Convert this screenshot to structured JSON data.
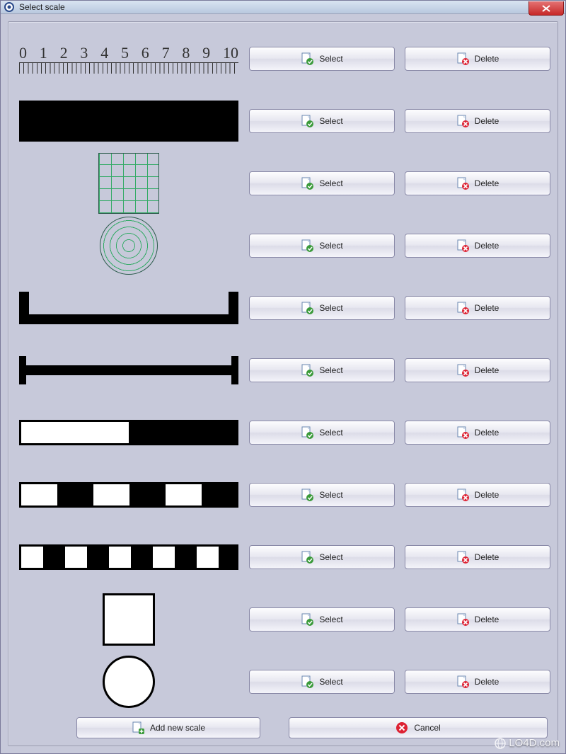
{
  "window": {
    "title": "Select scale"
  },
  "ruler_labels": [
    "0",
    "1",
    "2",
    "3",
    "4",
    "5",
    "6",
    "7",
    "8",
    "9",
    "10"
  ],
  "buttons": {
    "select": "Select",
    "delete": "Delete",
    "add": "Add new scale",
    "cancel": "Cancel"
  },
  "rows": [
    {
      "id": "ruler"
    },
    {
      "id": "blackbar"
    },
    {
      "id": "grid"
    },
    {
      "id": "circles"
    },
    {
      "id": "ubar"
    },
    {
      "id": "ibar"
    },
    {
      "id": "halfbar"
    },
    {
      "id": "thirds"
    },
    {
      "id": "fifths"
    },
    {
      "id": "square"
    },
    {
      "id": "circle"
    }
  ],
  "watermark": "LO4D.com"
}
